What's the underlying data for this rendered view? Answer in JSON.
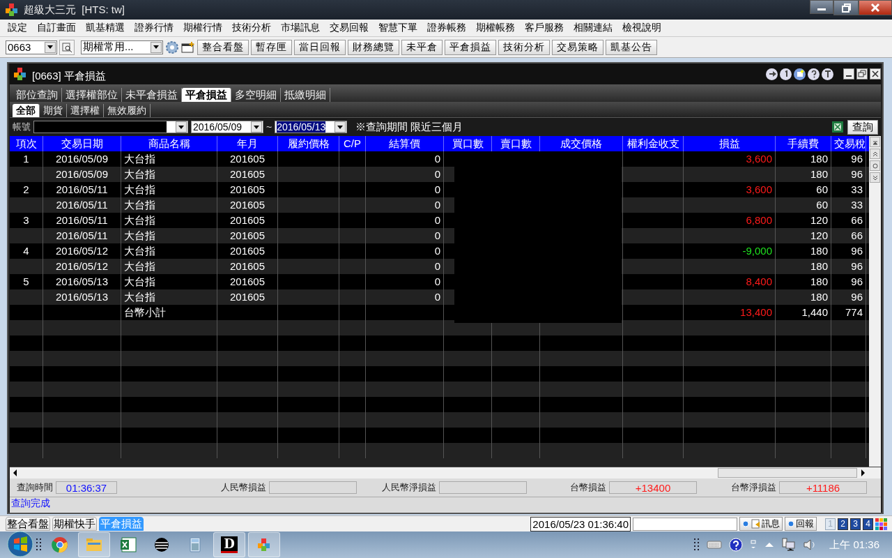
{
  "window": {
    "title": "超級大三元  [HTS: tw]"
  },
  "menu": [
    "設定",
    "自訂畫面",
    "凱基精選",
    "證券行情",
    "期權行情",
    "技術分析",
    "市場訊息",
    "交易回報",
    "智慧下單",
    "證券帳務",
    "期權帳務",
    "客戶服務",
    "相關連結",
    "檢視說明"
  ],
  "toolbar": {
    "code": "0663",
    "preset": "期權常用...",
    "buttons": [
      "整合看盤",
      "暫存匣",
      "當日回報",
      "財務總覽",
      "未平倉",
      "平倉損益",
      "技術分析",
      "交易策略",
      "凱基公告"
    ]
  },
  "panel": {
    "title": "[0663] 平倉損益",
    "tabs": [
      {
        "label": "部位查詢",
        "selected": false
      },
      {
        "label": "選擇權部位",
        "selected": false
      },
      {
        "label": "未平倉損益",
        "selected": false
      },
      {
        "label": "平倉損益",
        "selected": true
      },
      {
        "label": "多空明細",
        "selected": false
      },
      {
        "label": "抵繳明細",
        "selected": false
      }
    ],
    "subtabs": [
      {
        "label": "全部",
        "selected": true
      },
      {
        "label": "期貨",
        "selected": false
      },
      {
        "label": "選擇權",
        "selected": false
      },
      {
        "label": "無效履約",
        "selected": false
      }
    ],
    "filter": {
      "account_label": "帳號",
      "date_from": "2016/05/09",
      "separator": "~",
      "date_to": "2016/05/13",
      "note": "※查詢期間 限近三個月",
      "query_button": "查詢"
    },
    "table": {
      "columns": [
        "項次",
        "交易日期",
        "商品名稱",
        "年月",
        "履約價格",
        "C/P",
        "結算價",
        "買口數",
        "賣口數",
        "成交價格",
        "權利金收支",
        "損益",
        "手續費",
        "交易稅"
      ],
      "rows": [
        {
          "no": "1",
          "date": "2016/05/09",
          "product": "大台指",
          "month": "201605",
          "settle": "0",
          "pnl": {
            "value": "3,600",
            "color": "#ff1a1a"
          },
          "fee": "180",
          "tax": "96"
        },
        {
          "date": "2016/05/09",
          "product": "大台指",
          "month": "201605",
          "settle": "0",
          "fee": "180",
          "tax": "96"
        },
        {
          "no": "2",
          "date": "2016/05/11",
          "product": "大台指",
          "month": "201605",
          "settle": "0",
          "pnl": {
            "value": "3,600",
            "color": "#ff1a1a"
          },
          "fee": "60",
          "tax": "33"
        },
        {
          "date": "2016/05/11",
          "product": "大台指",
          "month": "201605",
          "settle": "0",
          "fee": "60",
          "tax": "33"
        },
        {
          "no": "3",
          "date": "2016/05/11",
          "product": "大台指",
          "month": "201605",
          "settle": "0",
          "pnl": {
            "value": "6,800",
            "color": "#ff1a1a"
          },
          "fee": "120",
          "tax": "66"
        },
        {
          "date": "2016/05/11",
          "product": "大台指",
          "month": "201605",
          "settle": "0",
          "fee": "120",
          "tax": "66"
        },
        {
          "no": "4",
          "date": "2016/05/12",
          "product": "大台指",
          "month": "201605",
          "settle": "0",
          "pnl": {
            "value": "-9,000",
            "color": "#1ee01e"
          },
          "fee": "180",
          "tax": "96"
        },
        {
          "date": "2016/05/12",
          "product": "大台指",
          "month": "201605",
          "settle": "0",
          "fee": "180",
          "tax": "96"
        },
        {
          "no": "5",
          "date": "2016/05/13",
          "product": "大台指",
          "month": "201605",
          "settle": "0",
          "pnl": {
            "value": "8,400",
            "color": "#ff1a1a"
          },
          "fee": "180",
          "tax": "96"
        },
        {
          "date": "2016/05/13",
          "product": "大台指",
          "month": "201605",
          "settle": "0",
          "fee": "180",
          "tax": "96"
        },
        {
          "product": "台幣小計",
          "pnl": {
            "value": "13,400",
            "color": "#ff1a1a"
          },
          "fee": "1,440",
          "tax": "774"
        }
      ]
    },
    "summary": [
      {
        "label": "查詢時間",
        "value": "01:36:37",
        "color": "#1010ff"
      },
      {
        "label": "人民幣損益"
      },
      {
        "label": "人民幣淨損益"
      },
      {
        "label": "台幣損益",
        "value": "+13400",
        "color": "#ff1a1a"
      },
      {
        "label": "台幣淨損益",
        "value": "+11186",
        "color": "#ff1a1a"
      }
    ],
    "message": "查詢完成"
  },
  "app_status": {
    "tabs": [
      {
        "label": "整合看盤",
        "selected": false
      },
      {
        "label": "期權快手",
        "selected": false
      },
      {
        "label": "平倉損益",
        "selected": true
      }
    ],
    "datetime": "2016/05/23 01:36:40",
    "buttons": [
      "訊息",
      "回報"
    ],
    "pages": [
      {
        "label": "1",
        "selected": true
      },
      {
        "label": "2",
        "selected": false
      },
      {
        "label": "3",
        "selected": false
      },
      {
        "label": "4",
        "selected": false
      }
    ]
  },
  "taskbar": {
    "apps": [
      {
        "kind": "browser"
      },
      {
        "kind": "folder"
      },
      {
        "kind": "spreadsheet"
      },
      {
        "kind": "swirl"
      },
      {
        "kind": "calculator"
      },
      {
        "kind": "letter",
        "label": "D"
      },
      {
        "kind": "blocks"
      }
    ],
    "clock": "上午 01:36"
  }
}
